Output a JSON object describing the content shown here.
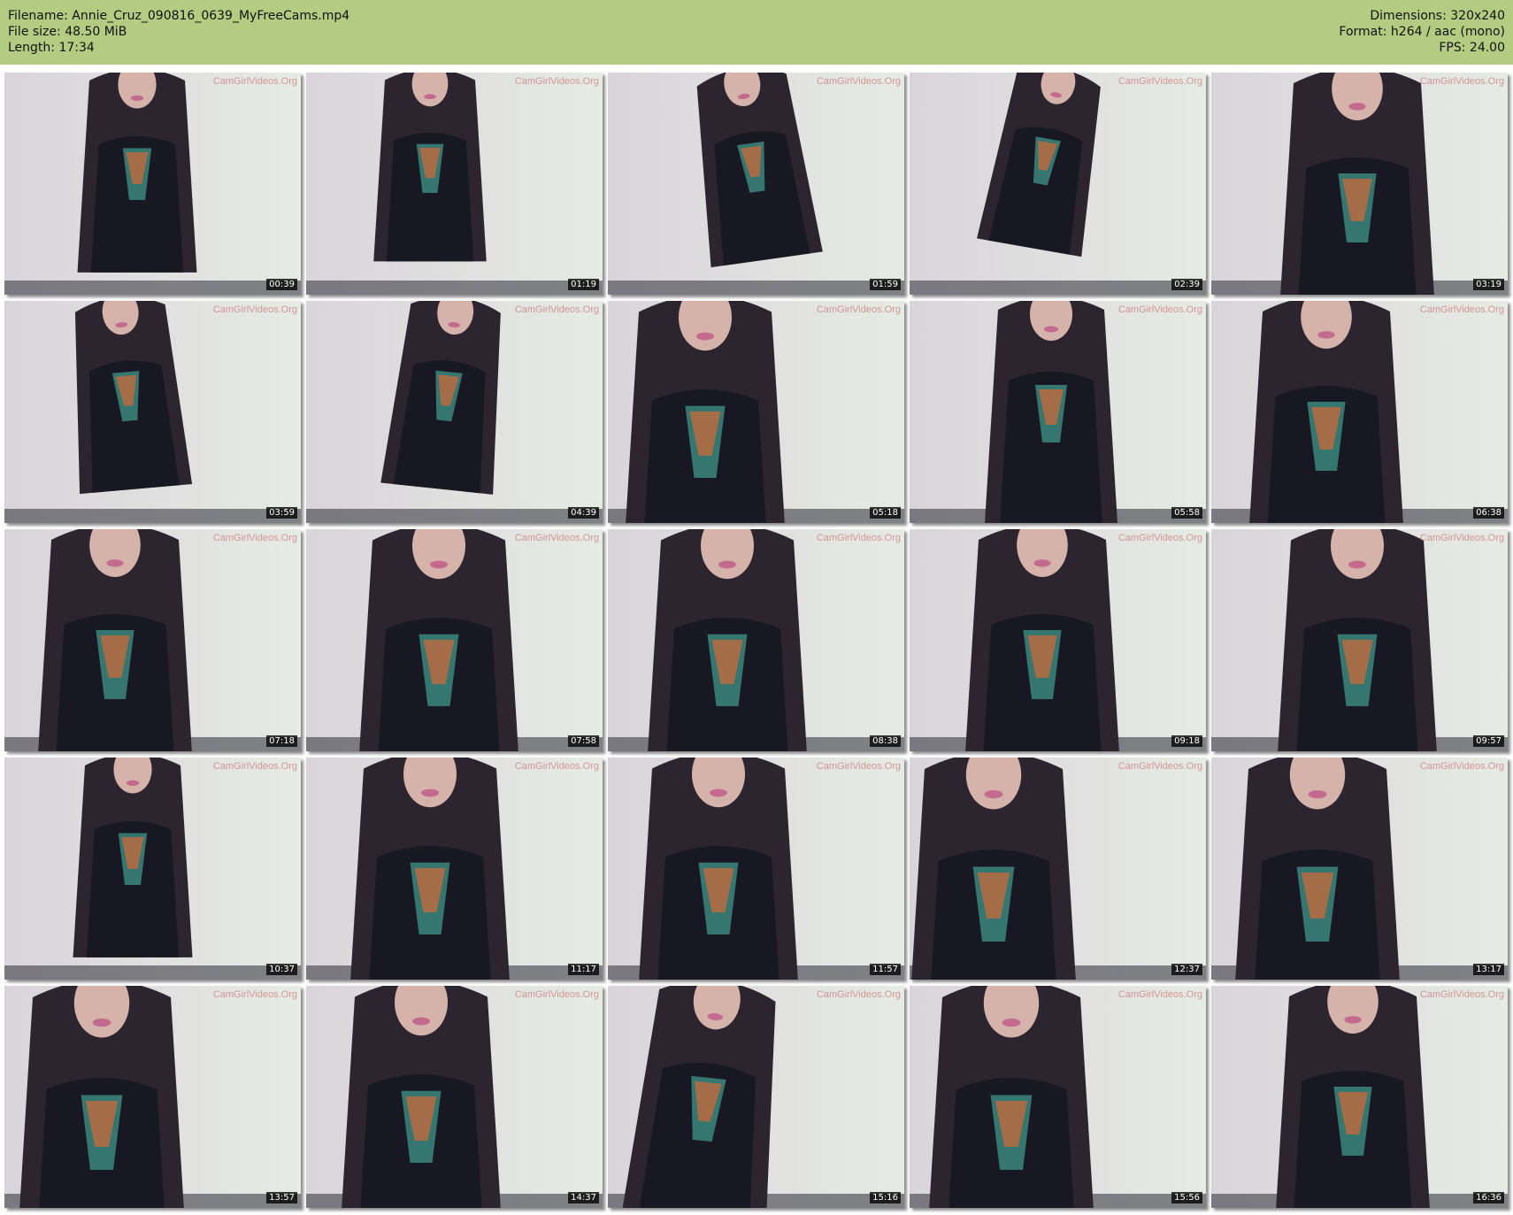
{
  "info": {
    "filename": "Filename: Annie_Cruz_090816_0639_MyFreeCams.mp4",
    "filesize": "File size: 48.50 MiB",
    "length": "Length: 17:34",
    "dimensions": "Dimensions: 320x240",
    "format": "Format: h264 / aac (mono)",
    "fps": "FPS: 24.00"
  },
  "watermark": "CamGirlVideos.Org",
  "colors": {
    "header_bg": "#b3cc82",
    "wall": "#d9d4da",
    "wall_light": "#e6ebe4",
    "hair": "#2c2530",
    "dress": "#181822",
    "skin": "#d6b3aa"
  },
  "thumbnails": [
    {
      "time": "00:39"
    },
    {
      "time": "01:19"
    },
    {
      "time": "01:59"
    },
    {
      "time": "02:39"
    },
    {
      "time": "03:19"
    },
    {
      "time": "03:59"
    },
    {
      "time": "04:39"
    },
    {
      "time": "05:18"
    },
    {
      "time": "05:58"
    },
    {
      "time": "06:38"
    },
    {
      "time": "07:18"
    },
    {
      "time": "07:58"
    },
    {
      "time": "08:38"
    },
    {
      "time": "09:18"
    },
    {
      "time": "09:57"
    },
    {
      "time": "10:37"
    },
    {
      "time": "11:17"
    },
    {
      "time": "11:57"
    },
    {
      "time": "12:37"
    },
    {
      "time": "13:17"
    },
    {
      "time": "13:57"
    },
    {
      "time": "14:37"
    },
    {
      "time": "15:16"
    },
    {
      "time": "15:56"
    },
    {
      "time": "16:36"
    }
  ]
}
